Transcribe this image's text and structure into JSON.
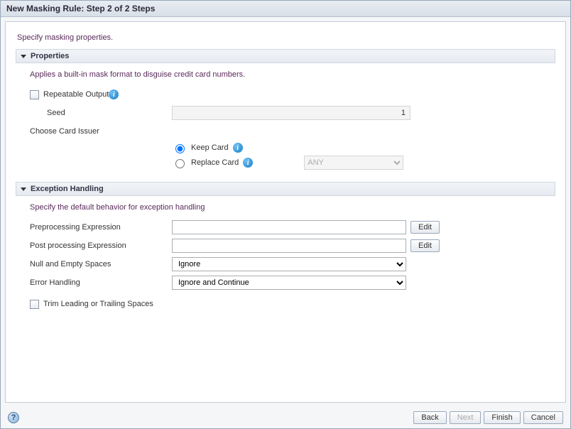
{
  "window": {
    "title": "New Masking Rule: Step 2 of 2 Steps"
  },
  "page": {
    "instruction": "Specify masking properties."
  },
  "properties": {
    "header": "Properties",
    "description": "Applies a built-in mask format to disguise credit card numbers.",
    "repeatable_label": "Repeatable Output",
    "repeatable_checked": false,
    "seed_label": "Seed",
    "seed_value": "1",
    "issuer_label": "Choose Card Issuer",
    "keep_label": "Keep Card",
    "replace_label": "Replace Card",
    "issuer_selected": "keep",
    "replace_dropdown_value": "ANY"
  },
  "exception": {
    "header": "Exception Handling",
    "description": "Specify the default behavior for exception handling",
    "pre_label": "Preprocessing Expression",
    "pre_value": "",
    "post_label": "Post processing Expression",
    "post_value": "",
    "null_label": "Null and Empty Spaces",
    "null_value": "Ignore",
    "error_label": "Error Handling",
    "error_value": "Ignore and Continue",
    "trim_label": "Trim Leading or Trailing Spaces",
    "trim_checked": false,
    "edit_label": "Edit"
  },
  "footer": {
    "back": "Back",
    "next": "Next",
    "finish": "Finish",
    "cancel": "Cancel"
  }
}
